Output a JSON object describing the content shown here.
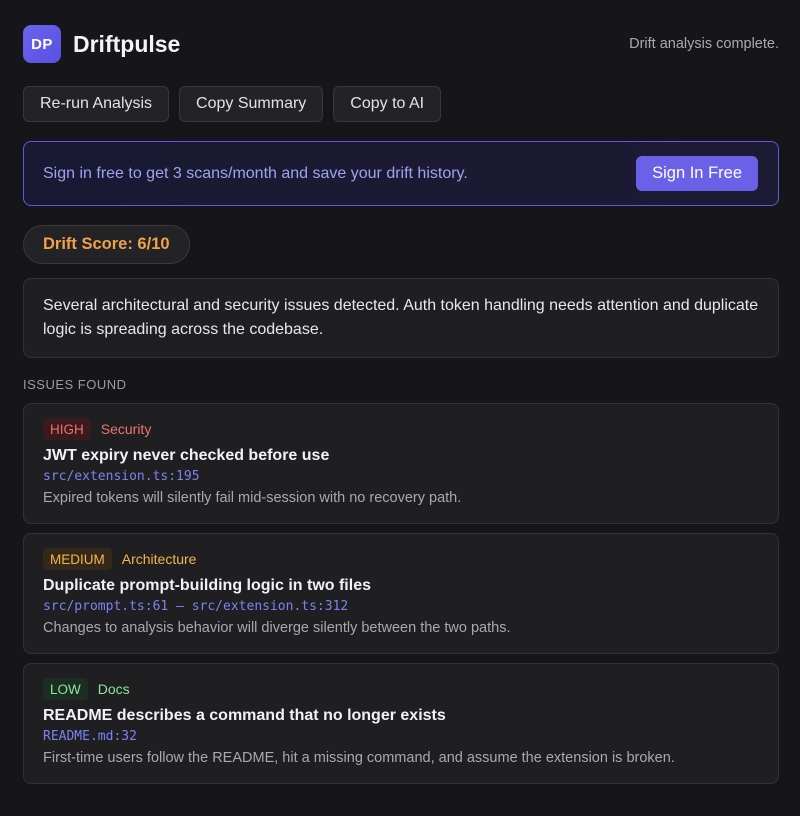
{
  "app": {
    "logo_text": "DP",
    "title": "Driftpulse",
    "status": "Drift analysis complete."
  },
  "toolbar": {
    "rerun_label": "Re-run Analysis",
    "copy_summary_label": "Copy Summary",
    "copy_ai_label": "Copy to AI"
  },
  "banner": {
    "text": "Sign in free to get 3 scans/month and save your drift history.",
    "button_label": "Sign In Free"
  },
  "score": {
    "label": "Drift Score: 6/10",
    "value": 6,
    "max": 10
  },
  "summary": "Several architectural and security issues detected. Auth token handling needs attention and duplicate logic is spreading across the codebase.",
  "issues_section": {
    "label": "ISSUES FOUND",
    "items": [
      {
        "severity": "HIGH",
        "category": "Security",
        "title": "JWT expiry never checked before use",
        "location": "src/extension.ts:195",
        "description": "Expired tokens will silently fail mid-session with no recovery path."
      },
      {
        "severity": "MEDIUM",
        "category": "Architecture",
        "title": "Duplicate prompt-building logic in two files",
        "location": "src/prompt.ts:61 — src/extension.ts:312",
        "description": "Changes to analysis behavior will diverge silently between the two paths."
      },
      {
        "severity": "LOW",
        "category": "Docs",
        "title": "README describes a command that no longer exists",
        "location": "README.md:32",
        "description": "First-time users follow the README, hit a missing command, and assume the extension is broken."
      }
    ]
  },
  "colors": {
    "accent": "#6a61e8",
    "score": "#f0a24a",
    "high": "#ef6f6f",
    "medium": "#f4b54a",
    "low": "#8ce59a",
    "background": "#161618"
  }
}
